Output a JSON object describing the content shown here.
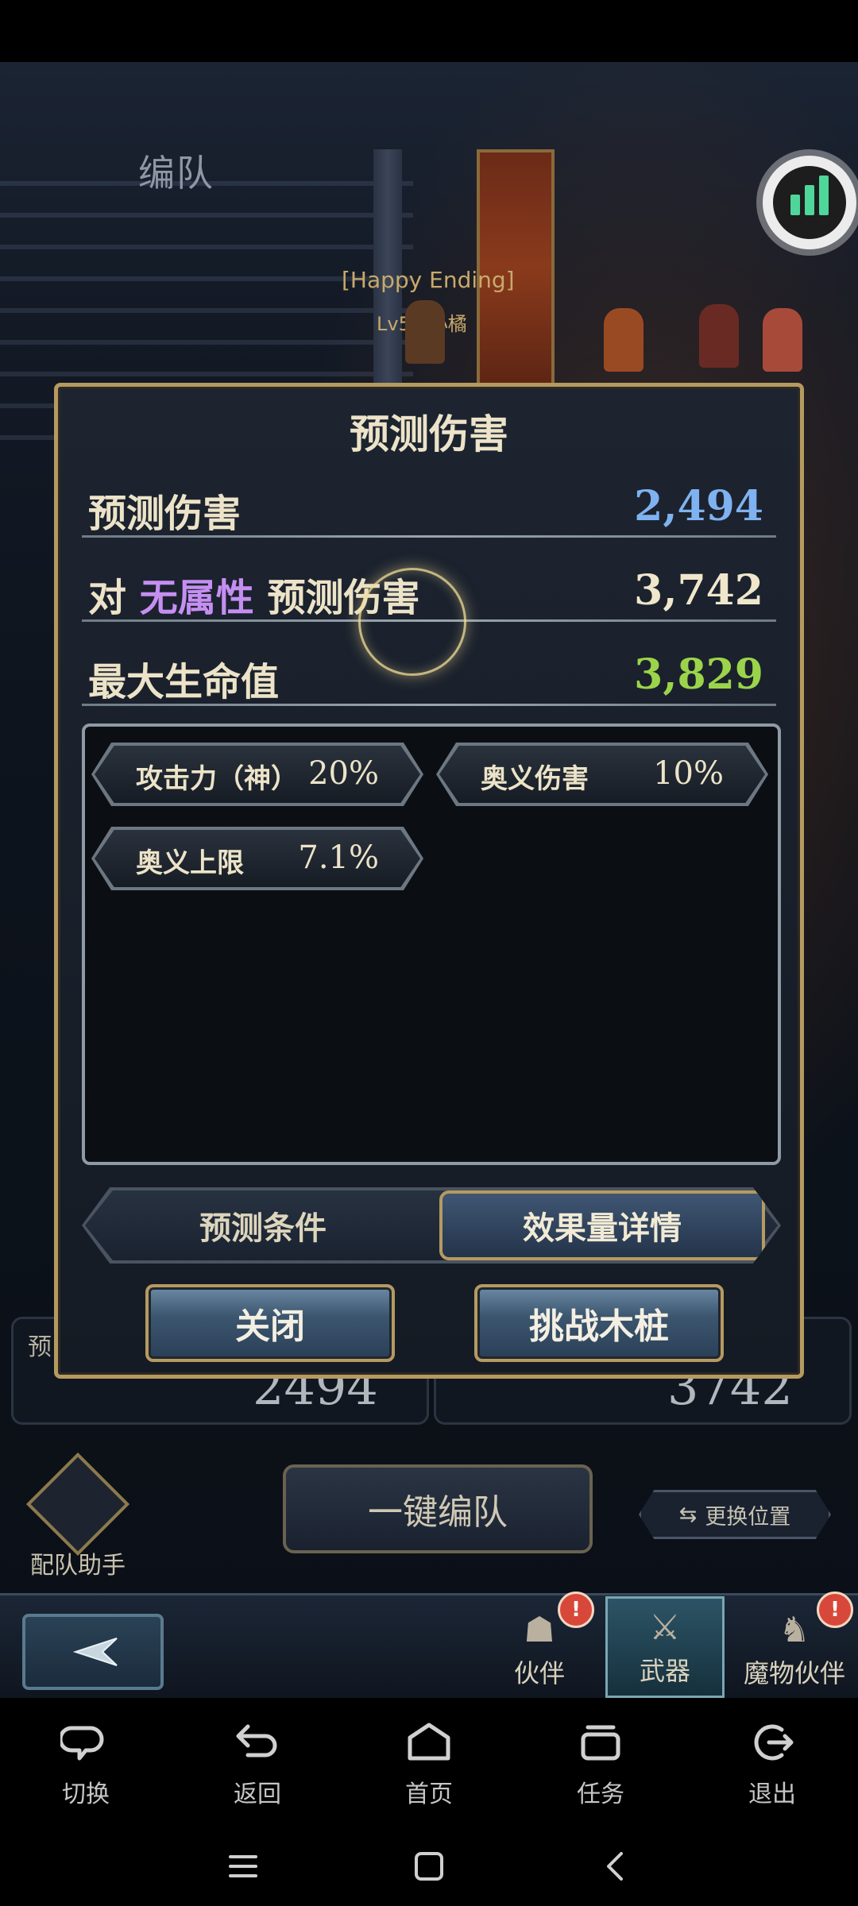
{
  "background": {
    "screen_title": "编队",
    "team_name": "[Happy Ending]",
    "level_text": "Lv50  小橘",
    "predict_left_label": "预",
    "predict_left_value": "2494",
    "predict_right_value": "3742",
    "helper_label": "配队助手",
    "auto_team_label": "一键编队",
    "swap_label": "更换位置",
    "tabs": [
      {
        "label": "伙伴",
        "badge": "!"
      },
      {
        "label": "武器",
        "badge": ""
      },
      {
        "label": "魔物伙伴",
        "badge": "!"
      }
    ]
  },
  "dialog": {
    "title": "预测伤害",
    "rows": [
      {
        "label": "预测伤害",
        "value": "2,494",
        "color": "#7fb2f0"
      },
      {
        "label_prefix": "对",
        "label_attr": "无属性",
        "label_suffix": "预测伤害",
        "value": "3,742",
        "color": "#efe6cc"
      },
      {
        "label": "最大生命值",
        "value": "3,829",
        "color": "#9bd44b"
      }
    ],
    "effects": [
      {
        "name": "攻击力（神）",
        "value": "20%"
      },
      {
        "name": "奥义伤害",
        "value": "10%"
      },
      {
        "name": "奥义上限",
        "value": "7.1%"
      }
    ],
    "tabs": {
      "conditions": "预测条件",
      "details": "效果量详情",
      "active": "details"
    },
    "buttons": {
      "close": "关闭",
      "challenge": "挑战木桩"
    }
  },
  "system_nav": {
    "items": [
      {
        "icon": "switch-icon",
        "label": "切换"
      },
      {
        "icon": "back-icon",
        "label": "返回"
      },
      {
        "icon": "home-icon",
        "label": "首页"
      },
      {
        "icon": "tasks-icon",
        "label": "任务"
      },
      {
        "icon": "exit-icon",
        "label": "退出"
      }
    ]
  },
  "colors": {
    "gold_border": "#b59a61",
    "blue_value": "#7fb2f0",
    "green_value": "#9bd44b",
    "attr_purple": "#c58ff2"
  }
}
